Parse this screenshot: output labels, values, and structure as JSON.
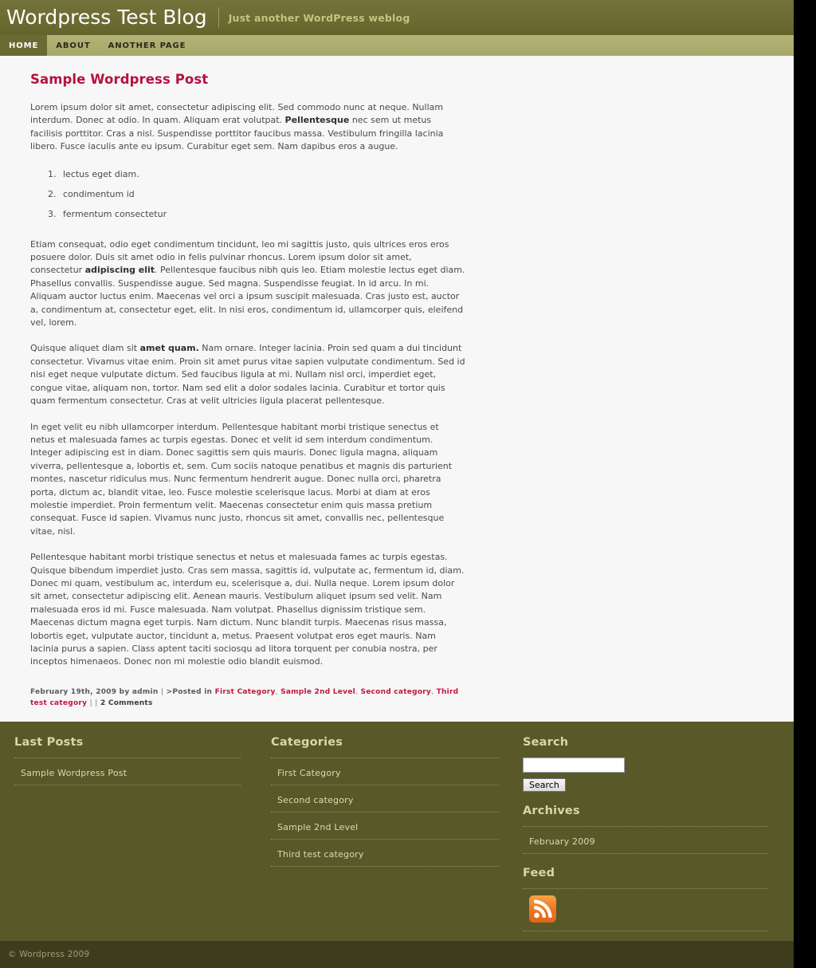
{
  "header": {
    "blog_title": "Wordpress Test Blog",
    "tagline": "Just another WordPress weblog",
    "bg_color": "#6b6b32",
    "title_color": "#ffffff",
    "tagline_color": "#c3c384"
  },
  "nav": {
    "bg_color": "#a7a76a",
    "active_bg_color": "#6a6a33",
    "items": [
      {
        "label": "HOME",
        "active": true
      },
      {
        "label": "ABOUT",
        "active": false
      },
      {
        "label": "ANOTHER PAGE",
        "active": false
      }
    ]
  },
  "post": {
    "title": "Sample Wordpress Post",
    "title_color": "#b5123e",
    "paragraph1_a": "Lorem ipsum dolor sit amet, consectetur adipiscing elit. Sed commodo nunc at neque. Nullam interdum. Donec at odio. In quam. Aliquam erat volutpat. ",
    "paragraph1_bold": "Pellentesque",
    "paragraph1_b": " nec sem ut metus facilisis porttitor. Cras a nisl. Suspendisse porttitor faucibus massa. Vestibulum fringilla lacinia libero. Fusce iaculis ante eu ipsum. Curabitur eget sem. Nam dapibus eros a augue.",
    "list_items": [
      "lectus eget diam.",
      "condimentum id",
      "fermentum consectetur"
    ],
    "paragraph2_a": "Etiam consequat, odio eget condimentum tincidunt, leo mi sagittis justo, quis ultrices eros eros posuere dolor. Duis sit amet odio in felis pulvinar rhoncus. Lorem ipsum dolor sit amet, consectetur ",
    "paragraph2_bold": "adipiscing elit",
    "paragraph2_b": ". Pellentesque faucibus nibh quis leo. Etiam molestie lectus eget diam. Phasellus convallis. Suspendisse augue. Sed magna. Suspendisse feugiat. In id arcu. In mi. Aliquam auctor luctus enim. Maecenas vel orci a ipsum suscipit malesuada. Cras justo est, auctor a, condimentum at, consectetur eget, elit. In nisi eros, condimentum id, ullamcorper quis, eleifend vel, lorem.",
    "paragraph3_a": "Quisque aliquet diam sit ",
    "paragraph3_bold": "amet quam.",
    "paragraph3_b": " Nam ornare. Integer lacinia. Proin sed quam a dui tincidunt consectetur. Vivamus vitae enim. Proin sit amet purus vitae sapien vulputate condimentum. Sed id nisi eget neque vulputate dictum. Sed faucibus ligula at mi. Nullam nisl orci, imperdiet eget, congue vitae, aliquam non, tortor. Nam sed elit a dolor sodales lacinia. Curabitur et tortor quis quam fermentum consectetur. Cras at velit ultricies ligula placerat pellentesque.",
    "paragraph4": "In eget velit eu nibh ullamcorper interdum. Pellentesque habitant morbi tristique senectus et netus et malesuada fames ac turpis egestas. Donec et velit id sem interdum condimentum. Integer adipiscing est in diam. Donec sagittis sem quis mauris. Donec ligula magna, aliquam viverra, pellentesque a, lobortis et, sem. Cum sociis natoque penatibus et magnis dis parturient montes, nascetur ridiculus mus. Nunc fermentum hendrerit augue. Donec nulla orci, pharetra porta, dictum ac, blandit vitae, leo. Fusce molestie scelerisque lacus. Morbi at diam at eros molestie imperdiet. Proin fermentum velit. Maecenas consectetur enim quis massa pretium consequat. Fusce id sapien. Vivamus nunc justo, rhoncus sit amet, convallis nec, pellentesque vitae, nisl.",
    "paragraph5": "Pellentesque habitant morbi tristique senectus et netus et malesuada fames ac turpis egestas. Quisque bibendum imperdiet justo. Cras sem massa, sagittis id, vulputate ac, fermentum id, diam. Donec mi quam, vestibulum ac, interdum eu, scelerisque a, dui. Nulla neque. Lorem ipsum dolor sit amet, consectetur adipiscing elit. Aenean mauris. Vestibulum aliquet ipsum sed velit. Nam malesuada eros id mi. Fusce malesuada. Nam volutpat. Phasellus dignissim tristique sem. Maecenas dictum magna eget turpis. Nam dictum. Nunc blandit turpis. Maecenas risus massa, lobortis eget, vulputate auctor, tincidunt a, metus. Praesent volutpat eros eget mauris. Nam lacinia purus a sapien. Class aptent taciti sociosqu ad litora torquent per conubia nostra, per inceptos himenaeos. Donec non mi molestie odio blandit euismod.",
    "meta": {
      "date_author": "February 19th, 2009 by admin",
      "sep1": "|",
      "posted_in": ">Posted in",
      "categories": [
        "First Category",
        "Sample 2nd Level",
        "Second category",
        "Third test category"
      ],
      "category_comma": ",",
      "sep2": "|",
      "sep3": "|",
      "comments": "2 Comments",
      "link_color": "#c0173f"
    }
  },
  "footer": {
    "bg_color": "#585829",
    "last_posts": {
      "title": "Last Posts",
      "items": [
        {
          "label": "Sample Wordpress Post"
        }
      ]
    },
    "categories": {
      "title": "Categories",
      "items": [
        {
          "label": "First Category"
        },
        {
          "label": "Second category"
        },
        {
          "label": "Sample 2nd Level"
        },
        {
          "label": "Third test category"
        }
      ]
    },
    "search": {
      "title": "Search",
      "value": "",
      "placeholder": "",
      "button_label": "Search"
    },
    "archives": {
      "title": "Archives",
      "items": [
        {
          "label": "February 2009"
        }
      ]
    },
    "feed": {
      "title": "Feed",
      "icon": "rss-icon",
      "icon_color": "#ee7b24"
    }
  },
  "copyright": {
    "text": "© Wordpress 2009",
    "bg_color": "#3d3d1e",
    "text_color": "#9d9d74"
  }
}
